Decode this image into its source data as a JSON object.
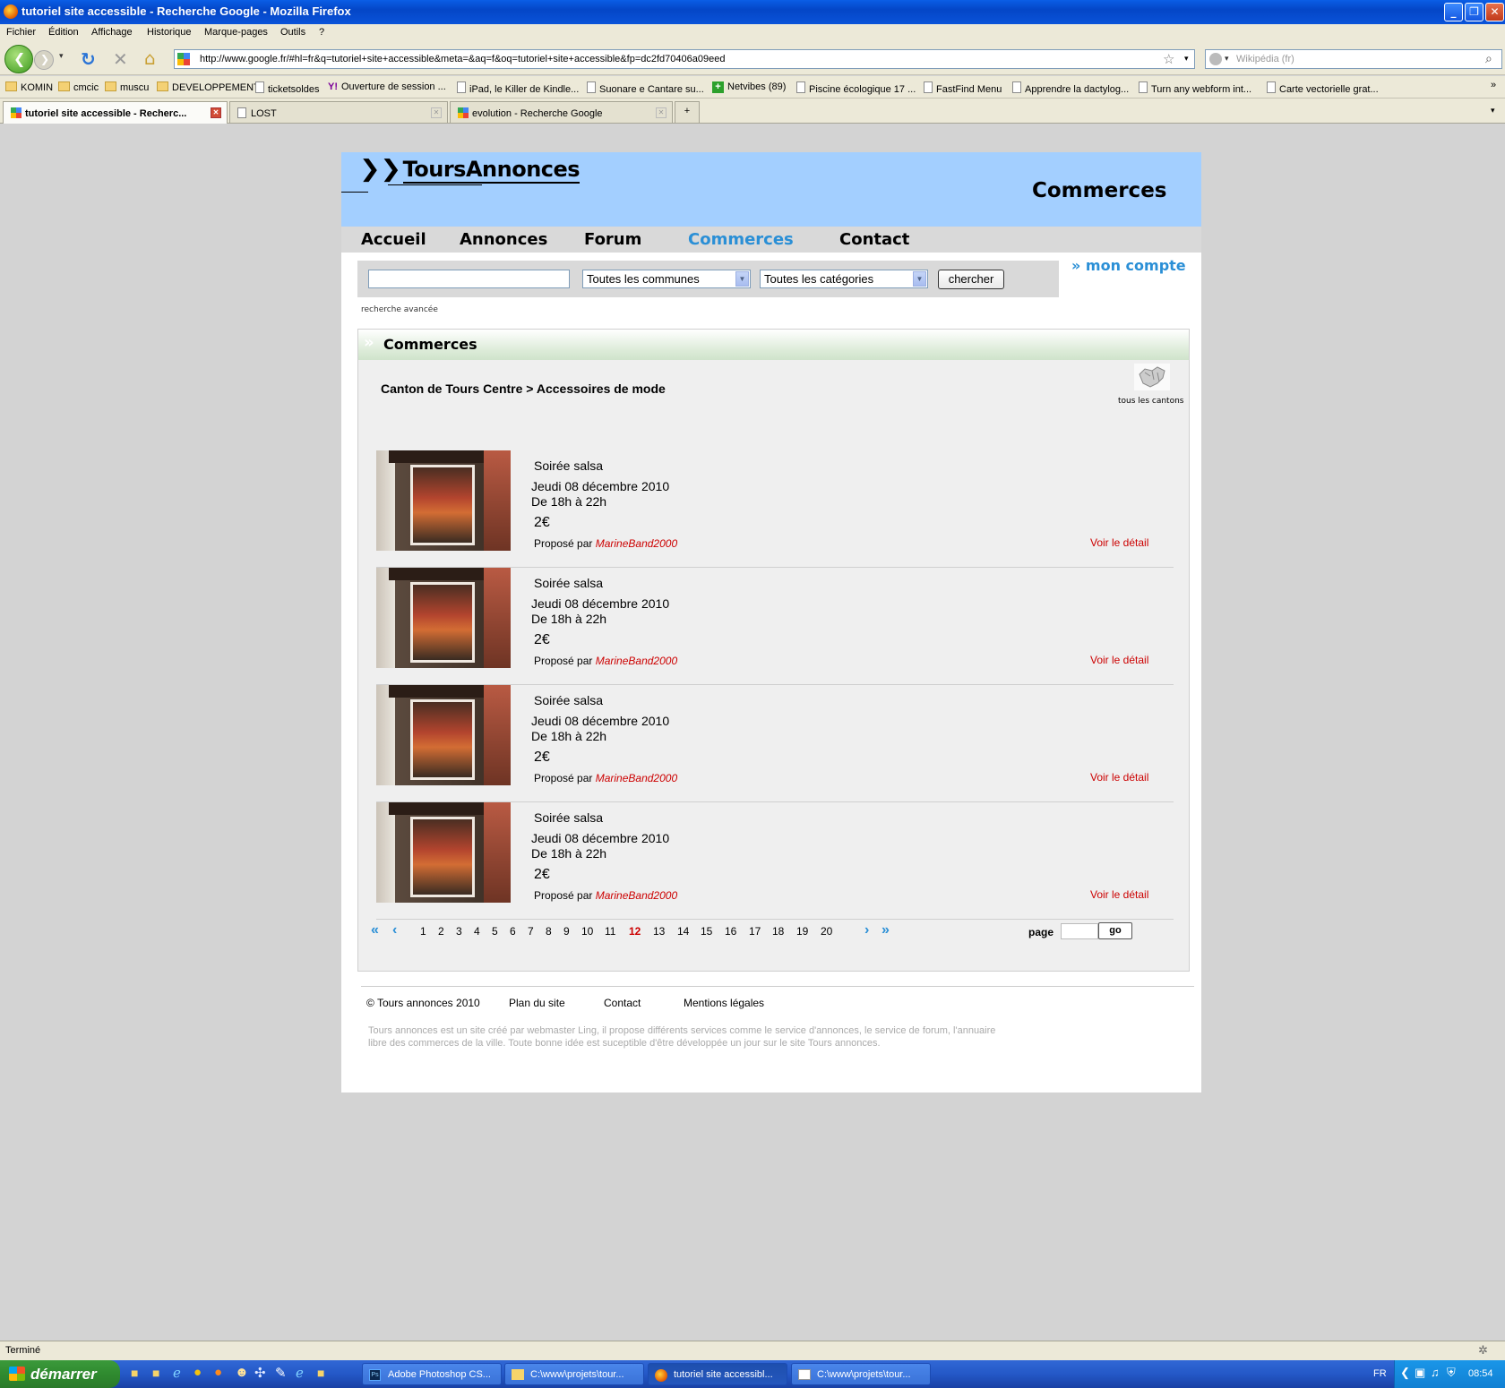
{
  "window": {
    "title": "tutoriel site accessible - Recherche Google - Mozilla Firefox"
  },
  "menu": [
    "Fichier",
    "Édition",
    "Affichage",
    "Historique",
    "Marque-pages",
    "Outils",
    "?"
  ],
  "toolbar": {
    "url": "http://www.google.fr/#hl=fr&q=tutoriel+site+accessible&meta=&aq=f&oq=tutoriel+site+accessible&fp=dc2fd70406a09eed",
    "search_placeholder": "Wikipédia (fr)"
  },
  "bookmarks": [
    {
      "label": "KOMIN",
      "icon": "folder-icon"
    },
    {
      "label": "cmcic",
      "icon": "folder-icon"
    },
    {
      "label": "muscu",
      "icon": "folder-icon"
    },
    {
      "label": "DEVELOPPEMENT",
      "icon": "folder-icon"
    },
    {
      "label": "ticketsoldes",
      "icon": "page-icon"
    },
    {
      "label": "Ouverture de session ...",
      "icon": "yahoo-icon"
    },
    {
      "label": "iPad, le Killer de Kindle...",
      "icon": "page-icon"
    },
    {
      "label": "Suonare e Cantare su...",
      "icon": "page-icon"
    },
    {
      "label": "Netvibes (89)",
      "icon": "plus-icon"
    },
    {
      "label": "Piscine écologique 17 ...",
      "icon": "page-icon"
    },
    {
      "label": "FastFind Menu",
      "icon": "page-icon"
    },
    {
      "label": "Apprendre la dactylog...",
      "icon": "page-icon"
    },
    {
      "label": "Turn any webform int...",
      "icon": "page-icon"
    },
    {
      "label": "Carte vectorielle grat...",
      "icon": "page-icon"
    }
  ],
  "tabs": [
    {
      "label": "tutoriel site accessible - Recherc...",
      "active": true
    },
    {
      "label": "LOST",
      "active": false
    },
    {
      "label": "evolution - Recherche Google",
      "active": false
    }
  ],
  "site": {
    "logo": "ToursAnnonces",
    "section_title": "Commerces",
    "nav": [
      "Accueil",
      "Annonces",
      "Forum",
      "Commerces",
      "Contact"
    ],
    "active_nav": "Commerces",
    "account_link": "mon compte",
    "search": {
      "query": "",
      "commune": "Toutes les communes",
      "category": "Toutes les catégories",
      "button": "chercher",
      "advanced": "recherche avancée"
    },
    "box_title": "Commerces",
    "breadcrumb": "Canton de Tours Centre > Accessoires de mode",
    "cantons_label": "tous les cantons",
    "listings": [
      {
        "title": "Soirée salsa",
        "date": "Jeudi 08 décembre 2010",
        "time": "De 18h à 22h",
        "price": "2€",
        "proposed_prefix": "Proposé par",
        "author": "MarineBand2000",
        "detail": "Voir le détail"
      },
      {
        "title": "Soirée salsa",
        "date": "Jeudi 08 décembre 2010",
        "time": "De 18h à 22h",
        "price": "2€",
        "proposed_prefix": "Proposé par",
        "author": "MarineBand2000",
        "detail": "Voir le détail"
      },
      {
        "title": "Soirée salsa",
        "date": "Jeudi 08 décembre 2010",
        "time": "De 18h à 22h",
        "price": "2€",
        "proposed_prefix": "Proposé par",
        "author": "MarineBand2000",
        "detail": "Voir le détail"
      },
      {
        "title": "Soirée salsa",
        "date": "Jeudi 08 décembre 2010",
        "time": "De 18h à 22h",
        "price": "2€",
        "proposed_prefix": "Proposé par",
        "author": "MarineBand2000",
        "detail": "Voir le détail"
      }
    ],
    "pagination": {
      "pages": [
        "1",
        "2",
        "3",
        "4",
        "5",
        "6",
        "7",
        "8",
        "9",
        "10",
        "11",
        "12",
        "13",
        "14",
        "15",
        "16",
        "17",
        "18",
        "19",
        "20"
      ],
      "current": "12",
      "page_label": "page",
      "go_label": "go"
    },
    "footer": {
      "copyright": "© Tours annonces 2010",
      "links": [
        "Plan du site",
        "Contact",
        "Mentions légales"
      ],
      "description": "Tours annonces est un site créé par webmaster Ling, il propose différents services comme le service d'annonces, le service de forum, l'annuaire libre des commerces de la ville. Toute bonne idée est suceptible d'être développée un jour sur le site Tours annonces."
    }
  },
  "status": "Terminé",
  "taskbar": {
    "start": "démarrer",
    "buttons": [
      {
        "label": "Adobe Photoshop CS...",
        "active": false
      },
      {
        "label": "C:\\www\\projets\\tour...",
        "active": false
      },
      {
        "label": "tutoriel site accessibl...",
        "active": true
      },
      {
        "label": "C:\\www\\projets\\tour...",
        "active": false
      }
    ],
    "lang": "FR",
    "clock": "08:54"
  },
  "colors": {
    "header_bg": "#a3cfff",
    "accent_blue": "#2a8fd6",
    "link_red": "#cc0000"
  }
}
